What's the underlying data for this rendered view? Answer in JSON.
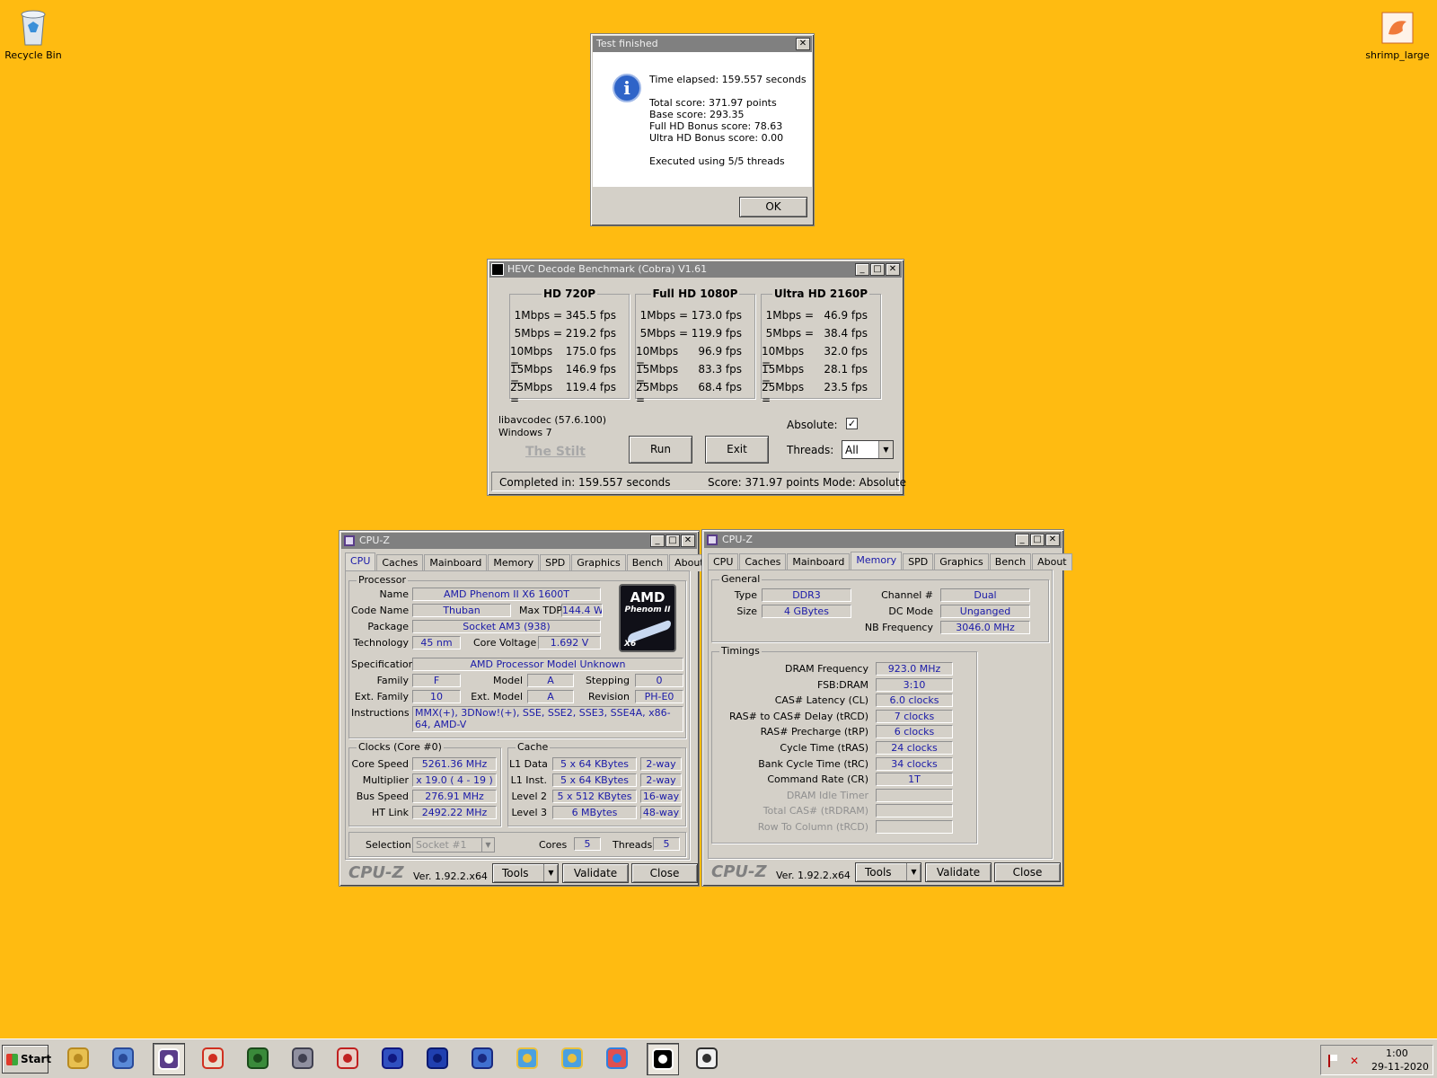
{
  "desktop": {
    "icons": [
      {
        "label": "Recycle Bin"
      },
      {
        "label": "shrimp_large"
      }
    ]
  },
  "dialog": {
    "title": "Test finished",
    "time": "Time elapsed:  159.557 seconds",
    "total": "Total score:  371.97 points",
    "base": "Base score: 293.35",
    "fullhd": "Full HD Bonus score: 78.63",
    "ultrahd": "Ultra HD Bonus score: 0.00",
    "threads": "Executed using 5/5 threads",
    "ok": "OK"
  },
  "hevc": {
    "title": "HEVC Decode Benchmark (Cobra) V1.61",
    "groups": [
      {
        "name": "HD 720P",
        "rows": [
          {
            "rate": "1Mbps =",
            "fps": "345.5 fps"
          },
          {
            "rate": "5Mbps =",
            "fps": "219.2 fps"
          },
          {
            "rate": "10Mbps =",
            "fps": "175.0 fps"
          },
          {
            "rate": "15Mbps =",
            "fps": "146.9 fps"
          },
          {
            "rate": "25Mbps =",
            "fps": "119.4 fps"
          }
        ]
      },
      {
        "name": "Full HD 1080P",
        "rows": [
          {
            "rate": "1Mbps =",
            "fps": "173.0 fps"
          },
          {
            "rate": "5Mbps =",
            "fps": "119.9 fps"
          },
          {
            "rate": "10Mbps =",
            "fps": "96.9 fps"
          },
          {
            "rate": "15Mbps =",
            "fps": "83.3 fps"
          },
          {
            "rate": "25Mbps =",
            "fps": "68.4 fps"
          }
        ]
      },
      {
        "name": "Ultra HD 2160P",
        "rows": [
          {
            "rate": "1Mbps =",
            "fps": "46.9 fps"
          },
          {
            "rate": "5Mbps =",
            "fps": "38.4 fps"
          },
          {
            "rate": "10Mbps =",
            "fps": "32.0 fps"
          },
          {
            "rate": "15Mbps =",
            "fps": "28.1 fps"
          },
          {
            "rate": "25Mbps =",
            "fps": "23.5 fps"
          }
        ]
      }
    ],
    "lib": "libavcodec (57.6.100)",
    "os": "Windows 7",
    "author": "The Stilt",
    "run": "Run",
    "exit": "Exit",
    "absolute_label": "Absolute:",
    "absolute_check": "✓",
    "threads_label": "Threads:",
    "threads_value": "All",
    "status_completed": "Completed in: 159.557 seconds",
    "status_score": "Score: 371.97 points",
    "status_mode": "Mode: Absolute"
  },
  "cpuz_cpu": {
    "title": "CPU-Z",
    "tabs": [
      "CPU",
      "Caches",
      "Mainboard",
      "Memory",
      "SPD",
      "Graphics",
      "Bench",
      "About"
    ],
    "processor": "Processor",
    "name_l": "Name",
    "name": "AMD Phenom II X6 1600T",
    "codename_l": "Code Name",
    "codename": "Thuban",
    "maxtdp_l": "Max TDP",
    "maxtdp": "144.4 W",
    "package_l": "Package",
    "package": "Socket AM3 (938)",
    "tech_l": "Technology",
    "tech": "45 nm",
    "cv_l": "Core Voltage",
    "cv": "1.692 V",
    "spec_l": "Specification",
    "spec": "AMD Processor Model Unknown",
    "family_l": "Family",
    "family": "F",
    "model_l": "Model",
    "model": "A",
    "stepping_l": "Stepping",
    "stepping": "0",
    "extfam_l": "Ext. Family",
    "extfam": "10",
    "extmodel_l": "Ext. Model",
    "extmodel": "A",
    "revision_l": "Revision",
    "revision": "PH-E0",
    "instr_l": "Instructions",
    "instr": "MMX(+), 3DNow!(+), SSE, SSE2, SSE3, SSE4A, x86-64, AMD-V",
    "logo1": "AMD",
    "logo2": "Phenom II",
    "logo3": "X6",
    "clocks": "Clocks (Core #0)",
    "cs_l": "Core Speed",
    "cs": "5261.36 MHz",
    "mult_l": "Multiplier",
    "mult": "x 19.0 ( 4 - 19 )",
    "bus_l": "Bus Speed",
    "bus": "276.91 MHz",
    "ht_l": "HT Link",
    "ht": "2492.22 MHz",
    "cache": "Cache",
    "l1d_l": "L1 Data",
    "l1d": "5 x 64 KBytes",
    "l1d_w": "2-way",
    "l1i_l": "L1 Inst.",
    "l1i": "5 x 64 KBytes",
    "l1i_w": "2-way",
    "l2_l": "Level 2",
    "l2": "5 x 512 KBytes",
    "l2_w": "16-way",
    "l3_l": "Level 3",
    "l3": "6 MBytes",
    "l3_w": "48-way",
    "sel_l": "Selection",
    "sel": "Socket #1",
    "cores_l": "Cores",
    "cores": "5",
    "threads_l": "Threads",
    "threads": "5",
    "brand": "CPU-Z",
    "ver": "Ver. 1.92.2.x64",
    "tools": "Tools",
    "validate": "Validate",
    "close": "Close"
  },
  "cpuz_mem": {
    "title": "CPU-Z",
    "tabs": [
      "CPU",
      "Caches",
      "Mainboard",
      "Memory",
      "SPD",
      "Graphics",
      "Bench",
      "About"
    ],
    "general": "General",
    "type_l": "Type",
    "type": "DDR3",
    "channel_l": "Channel #",
    "channel": "Dual",
    "size_l": "Size",
    "size": "4 GBytes",
    "dc_l": "DC Mode",
    "dc": "Unganged",
    "nb_l": "NB Frequency",
    "nb": "3046.0 MHz",
    "timings": "Timings",
    "t": [
      {
        "l": "DRAM Frequency",
        "v": "923.0 MHz"
      },
      {
        "l": "FSB:DRAM",
        "v": "3:10"
      },
      {
        "l": "CAS# Latency (CL)",
        "v": "6.0 clocks"
      },
      {
        "l": "RAS# to CAS# Delay (tRCD)",
        "v": "7 clocks"
      },
      {
        "l": "RAS# Precharge (tRP)",
        "v": "6 clocks"
      },
      {
        "l": "Cycle Time (tRAS)",
        "v": "24 clocks"
      },
      {
        "l": "Bank Cycle Time (tRC)",
        "v": "34 clocks"
      },
      {
        "l": "Command Rate (CR)",
        "v": "1T"
      },
      {
        "l": "DRAM Idle Timer",
        "v": ""
      },
      {
        "l": "Total CAS# (tRDRAM)",
        "v": ""
      },
      {
        "l": "Row To Column (tRCD)",
        "v": ""
      }
    ],
    "brand": "CPU-Z",
    "ver": "Ver. 1.92.2.x64",
    "tools": "Tools",
    "validate": "Validate",
    "close": "Close"
  },
  "taskbar": {
    "start": "Start",
    "time": "1:00",
    "date": "29-11-2020"
  }
}
